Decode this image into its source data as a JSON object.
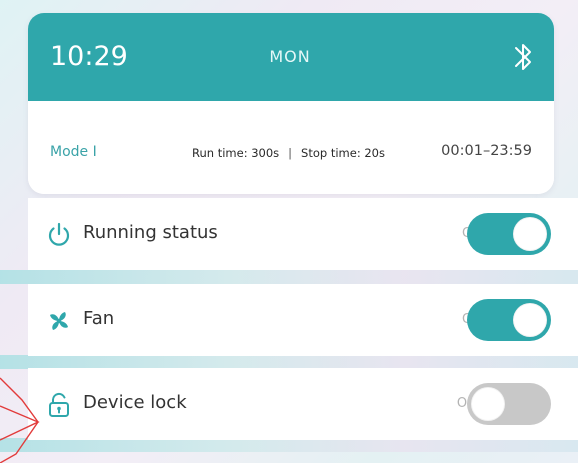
{
  "header": {
    "time": "10:29",
    "day": "MON",
    "bluetooth_icon": "bluetooth-icon"
  },
  "schedule": {
    "mode": "Mode I",
    "run_time": "Run time:  300s",
    "separator": "|",
    "stop_time": "Stop time:  20s",
    "time_range": "00:01–23:59"
  },
  "controls": [
    {
      "label": "Running status",
      "icon": "power-icon",
      "state": "ON",
      "on": true
    },
    {
      "label": "Fan",
      "icon": "fan-icon",
      "state": "ON",
      "on": true
    },
    {
      "label": "Device lock",
      "icon": "unlock-icon",
      "state": "OFF",
      "on": false
    }
  ],
  "colors": {
    "accent": "#2fa7ab",
    "toggle_off": "#c8c8c8",
    "annotation_arrow": "#e23b3b"
  }
}
